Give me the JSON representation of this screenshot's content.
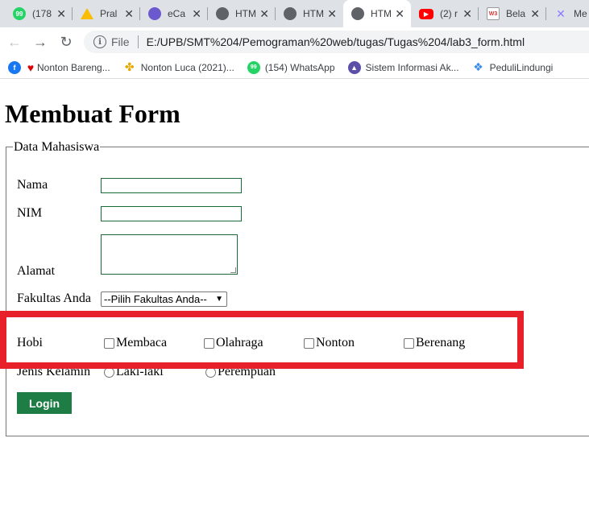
{
  "tabs": [
    {
      "title": "(178",
      "favicon": "whatsapp-icon"
    },
    {
      "title": "Pral",
      "favicon": "google-drive-icon"
    },
    {
      "title": "eCa",
      "favicon": "ecampus-icon"
    },
    {
      "title": "HTM",
      "favicon": "globe-icon"
    },
    {
      "title": "HTM",
      "favicon": "globe-icon"
    },
    {
      "title": "HTM",
      "favicon": "globe-icon",
      "active": true
    },
    {
      "title": "(2) r",
      "favicon": "youtube-icon"
    },
    {
      "title": "Bela",
      "favicon": "belajar-icon"
    },
    {
      "title": "Me",
      "favicon": "me-icon"
    }
  ],
  "toolbar": {
    "scheme_label": "File",
    "url": "E:/UPB/SMT%204/Pemograman%20web/tugas/Tugas%204/lab3_form.html"
  },
  "bookmarks": [
    {
      "label": "Nonton Bareng...",
      "icon": "facebook-heart-icon"
    },
    {
      "label": "Nonton Luca (2021)...",
      "icon": "pinwheel-icon"
    },
    {
      "label": "(154) WhatsApp",
      "icon": "whatsapp-icon"
    },
    {
      "label": "Sistem Informasi Ak...",
      "icon": "campus-icon"
    },
    {
      "label": "PeduliLindungi",
      "icon": "pedulilindungi-icon"
    }
  ],
  "page": {
    "heading": "Membuat Form",
    "legend": "Data Mahasiswa",
    "fields": {
      "nama_label": "Nama",
      "nim_label": "NIM",
      "alamat_label": "Alamat",
      "fakultas_label": "Fakultas Anda",
      "fakultas_selected": "--Pilih Fakultas Anda--",
      "hobi_label": "Hobi",
      "hobi_options": [
        "Membaca",
        "Olahraga",
        "Nonton",
        "Berenang"
      ],
      "jk_label": "Jenis Kelamin",
      "jk_options": [
        "Laki-laki",
        "Perempuan"
      ],
      "submit_label": "Login"
    }
  },
  "colors": {
    "highlight_border": "#e8202a",
    "button_bg": "#1d7d44",
    "input_border": "#1a6b3a"
  }
}
